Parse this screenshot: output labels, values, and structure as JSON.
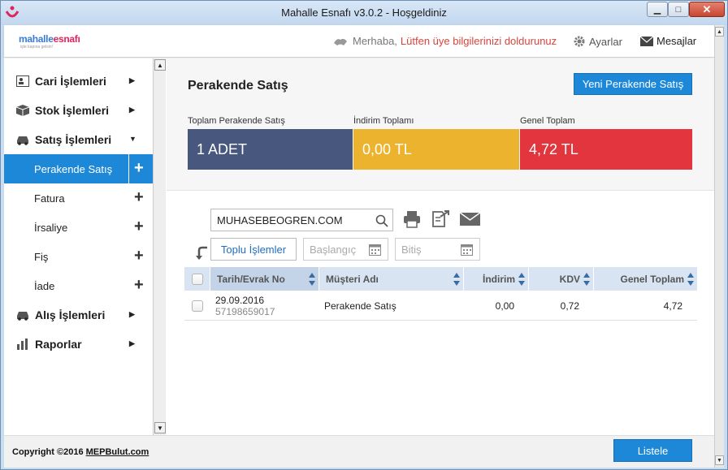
{
  "window": {
    "title": "Mahalle Esnafı v3.0.2 - Hoşgeldiniz",
    "minimize": "▁",
    "maximize": "□",
    "close": "✕"
  },
  "header": {
    "logo_text_1": "mahalle",
    "logo_text_2": "esnafı",
    "logo_tagline": "işte kapına gelsin!",
    "greeting": "Merhaba,",
    "warning": "Lütfen üye bilgilerinizi doldurunuz",
    "settings_label": "Ayarlar",
    "messages_label": "Mesajlar"
  },
  "sidebar": {
    "items": [
      {
        "label": "Cari İşlemleri",
        "icon": "contact-card-icon"
      },
      {
        "label": "Stok İşlemleri",
        "icon": "box-icon"
      },
      {
        "label": "Satış İşlemleri",
        "icon": "car-icon"
      }
    ],
    "sub_items": [
      {
        "label": "Perakende Satış"
      },
      {
        "label": "Fatura"
      },
      {
        "label": "İrsaliye"
      },
      {
        "label": "Fiş"
      },
      {
        "label": "İade"
      }
    ],
    "bottom_items": [
      {
        "label": "Alış İşlemleri",
        "icon": "car-icon"
      },
      {
        "label": "Raporlar",
        "icon": "bar-chart-icon"
      }
    ]
  },
  "main": {
    "title": "Perakende Satış",
    "new_button": "Yeni Perakende Satış",
    "cards": [
      {
        "label": "Toplam Perakende Satış",
        "value": "1 ADET",
        "color": "#47577e"
      },
      {
        "label": "İndirim Toplamı",
        "value": "0,00 TL",
        "color": "#ecb32f"
      },
      {
        "label": "Genel Toplam",
        "value": "4,72 TL",
        "color": "#e2353d"
      }
    ],
    "search_value": "MUHASEBEOGREN.COM",
    "bulk_button": "Toplu İşlemler",
    "date_start_placeholder": "Başlangıç",
    "date_end_placeholder": "Bitiş",
    "table": {
      "headers": [
        "Tarih/Evrak No",
        "Müşteri Adı",
        "İndirim",
        "KDV",
        "Genel Toplam"
      ],
      "rows": [
        {
          "date": "29.09.2016",
          "doc_no": "57198659017",
          "customer": "Perakende Satış",
          "discount": "0,00",
          "kdv": "0,72",
          "total": "4,72"
        }
      ]
    }
  },
  "footer": {
    "copyright_prefix": "Copyright ©2016",
    "copyright_link": "MEPBulut.com",
    "list_button": "Listele"
  },
  "colors": {
    "accent": "#1e88d8",
    "warning": "#d9453c"
  }
}
